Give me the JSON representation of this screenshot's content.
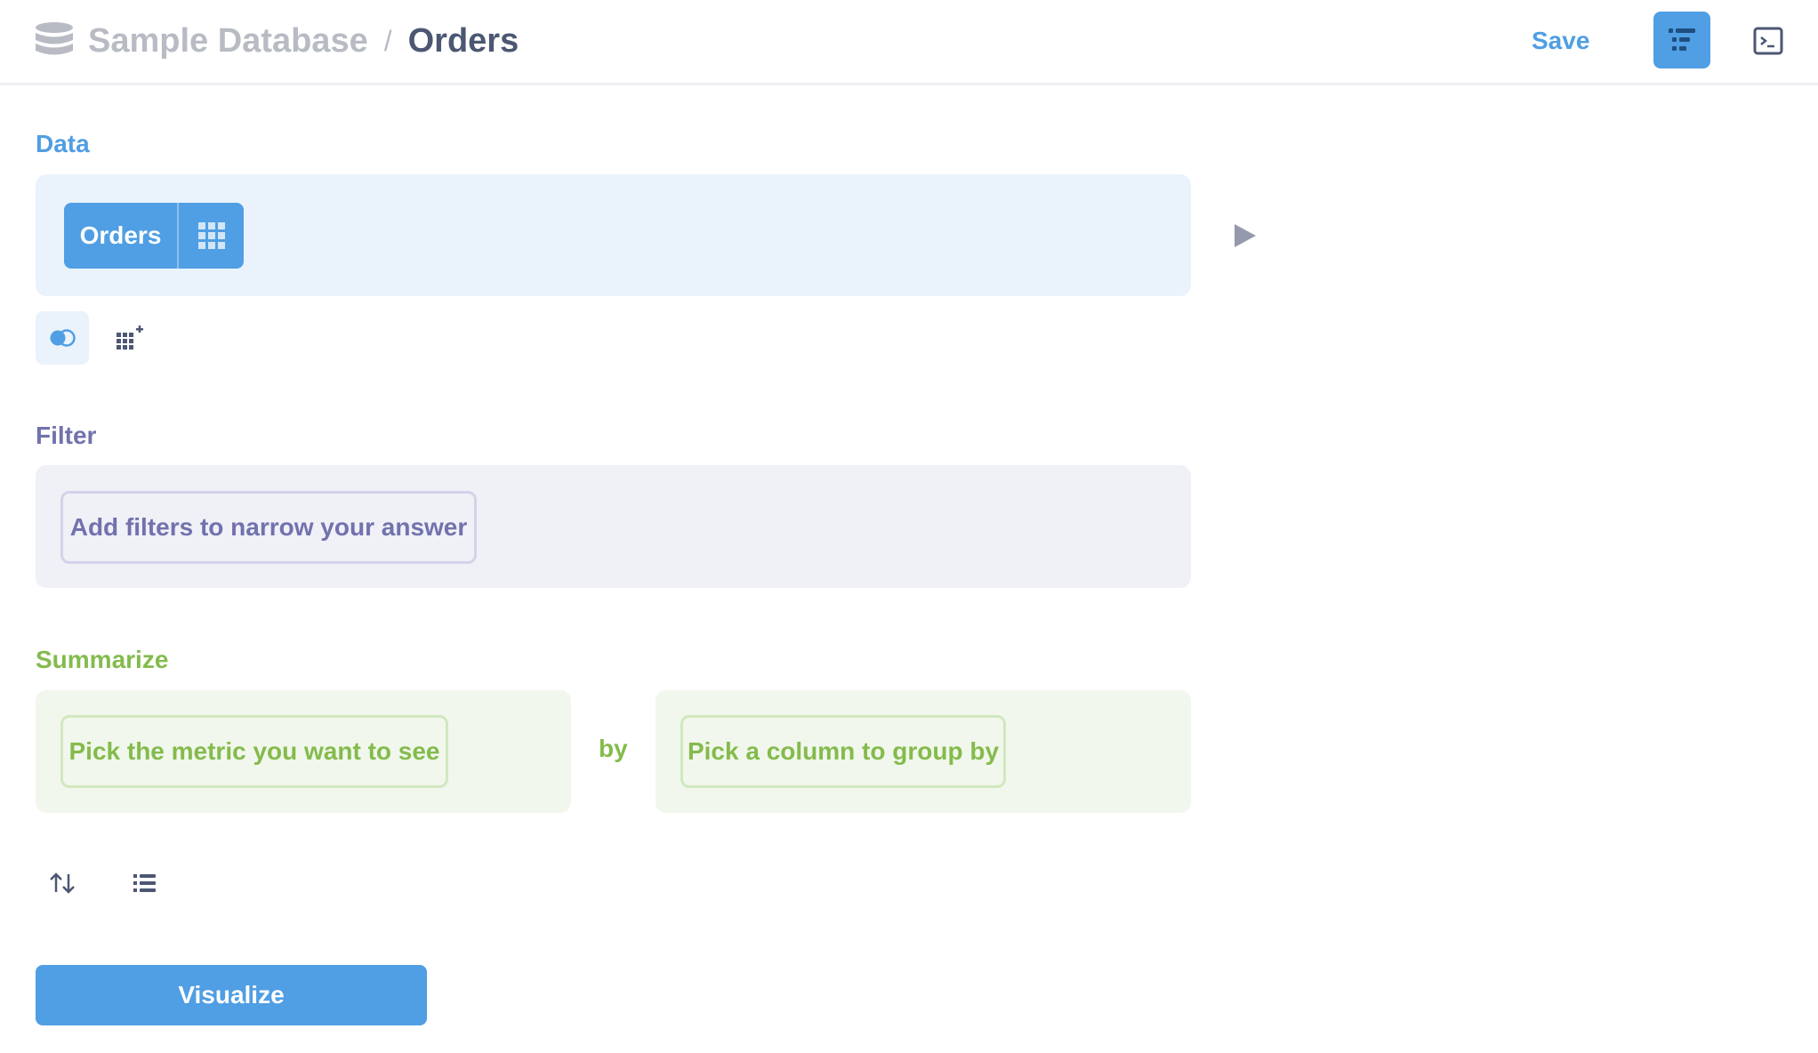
{
  "header": {
    "database": "Sample Database",
    "separator": "/",
    "table": "Orders",
    "save_label": "Save",
    "icons": {
      "database": "database-icon",
      "notebook": "notebook-icon",
      "sql": "sql-editor-icon"
    }
  },
  "data_section": {
    "label": "Data",
    "table_name": "Orders",
    "table_icon": "grid-icon",
    "run_icon": "play-icon",
    "actions": [
      "join-icon",
      "custom-column-icon"
    ]
  },
  "filter_section": {
    "label": "Filter",
    "placeholder": "Add filters to narrow your answer"
  },
  "summarize_section": {
    "label": "Summarize",
    "metric_placeholder": "Pick the metric you want to see",
    "by_label": "by",
    "group_placeholder": "Pick a column to group by",
    "actions": [
      "sort-icon",
      "limit-icon"
    ]
  },
  "visualize_label": "Visualize",
  "colors": {
    "brand": "#509ee3",
    "filter": "#7172ad",
    "summarize": "#84bb4c",
    "text_dark": "#4c5773",
    "text_muted": "#b8bbc3"
  }
}
